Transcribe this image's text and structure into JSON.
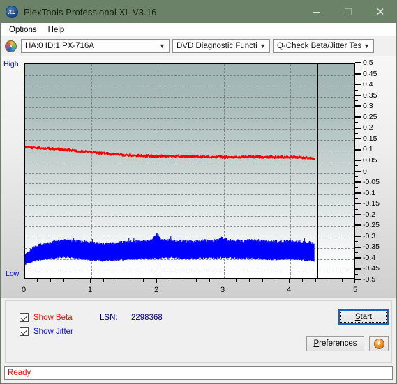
{
  "window": {
    "title": "PlexTools Professional XL V3.16",
    "app_icon": "xl-logo-icon",
    "minimize_label": "—",
    "maximize_label": "□",
    "close_label": "✕"
  },
  "menubar": {
    "items": [
      {
        "label": "Options",
        "accel": "O"
      },
      {
        "label": "Help",
        "accel": "H"
      }
    ]
  },
  "toolbar": {
    "drive_icon": "cd-disc-icon",
    "drive": {
      "value": "HA:0 ID:1  PX-716A",
      "chevron": "⌄"
    },
    "function": {
      "value": "DVD Diagnostic Functions",
      "chevron": "⌄"
    },
    "test": {
      "value": "Q-Check Beta/Jitter Test",
      "chevron": "⌄"
    }
  },
  "chart_data": {
    "type": "line",
    "title": "Q-Check Beta/Jitter Test",
    "xlabel": "",
    "ylabel": "",
    "xlim": [
      0,
      5
    ],
    "ylim": [
      -0.5,
      0.5
    ],
    "xticks": [
      0,
      1,
      2,
      3,
      4,
      5
    ],
    "xtick_labels": [
      "0",
      "1",
      "2",
      "3",
      "4",
      "5"
    ],
    "yticks": [
      0.5,
      0.45,
      0.4,
      0.35,
      0.3,
      0.25,
      0.2,
      0.15,
      0.1,
      0.05,
      0,
      -0.05,
      -0.1,
      -0.15,
      -0.2,
      -0.25,
      -0.3,
      -0.35,
      -0.4,
      -0.45,
      -0.5
    ],
    "ytick_labels": [
      "0.5",
      "0.45",
      "0.4",
      "0.35",
      "0.3",
      "0.25",
      "0.2",
      "0.15",
      "0.1",
      "0.05",
      "0",
      "-0.05",
      "-0.1",
      "-0.15",
      "-0.2",
      "-0.25",
      "-0.3",
      "-0.35",
      "-0.4",
      "-0.45",
      "-0.5"
    ],
    "axis_top_label": "High",
    "axis_bottom_label": "Low",
    "grid": true,
    "grid_style": "dashed",
    "data_end_x": 4.4,
    "legend_position": "below-left",
    "series": [
      {
        "name": "Beta",
        "color": "#ff0000",
        "x_start": 0.0,
        "x_end": 4.4,
        "description": "Beta value declines from about 0.11 near the disc start to about 0.06, then stays roughly flat with small noise",
        "x": [
          0.0,
          0.1,
          0.2,
          0.3,
          0.4,
          0.5,
          0.6,
          0.7,
          0.8,
          0.9,
          1.0,
          1.1,
          1.2,
          1.3,
          1.4,
          1.5,
          1.6,
          1.7,
          1.8,
          1.9,
          2.0,
          2.1,
          2.2,
          2.3,
          2.4,
          2.5,
          2.6,
          2.7,
          2.8,
          2.9,
          3.0,
          3.1,
          3.2,
          3.3,
          3.4,
          3.5,
          3.6,
          3.7,
          3.8,
          3.9,
          4.0,
          4.1,
          4.2,
          4.3,
          4.4
        ],
        "values": [
          0.112,
          0.11,
          0.109,
          0.107,
          0.105,
          0.103,
          0.1,
          0.098,
          0.095,
          0.092,
          0.089,
          0.086,
          0.083,
          0.08,
          0.078,
          0.076,
          0.074,
          0.073,
          0.072,
          0.071,
          0.069,
          0.072,
          0.071,
          0.07,
          0.069,
          0.068,
          0.068,
          0.067,
          0.067,
          0.066,
          0.066,
          0.065,
          0.064,
          0.065,
          0.068,
          0.067,
          0.066,
          0.066,
          0.065,
          0.066,
          0.066,
          0.065,
          0.064,
          0.062,
          0.058
        ]
      },
      {
        "name": "Jitter",
        "color": "#0000ff",
        "x_start": 0.0,
        "x_end": 4.4,
        "description": "Jitter drawn as a dense noisy band; upper and lower envelope given per x",
        "x": [
          0.0,
          0.1,
          0.2,
          0.3,
          0.4,
          0.5,
          0.6,
          0.7,
          0.8,
          0.9,
          1.0,
          1.1,
          1.2,
          1.3,
          1.4,
          1.5,
          1.6,
          1.7,
          1.8,
          1.9,
          2.0,
          2.1,
          2.2,
          2.3,
          2.4,
          2.5,
          2.6,
          2.7,
          2.8,
          2.9,
          3.0,
          3.1,
          3.2,
          3.3,
          3.4,
          3.5,
          3.6,
          3.7,
          3.8,
          3.9,
          4.0,
          4.1,
          4.2,
          4.3,
          4.4
        ],
        "upper": [
          -0.4,
          -0.37,
          -0.352,
          -0.345,
          -0.34,
          -0.334,
          -0.33,
          -0.332,
          -0.335,
          -0.338,
          -0.342,
          -0.345,
          -0.348,
          -0.345,
          -0.342,
          -0.34,
          -0.338,
          -0.336,
          -0.334,
          -0.336,
          -0.3,
          -0.332,
          -0.33,
          -0.332,
          -0.334,
          -0.336,
          -0.334,
          -0.332,
          -0.33,
          -0.332,
          -0.318,
          -0.33,
          -0.332,
          -0.334,
          -0.33,
          -0.332,
          -0.334,
          -0.336,
          -0.338,
          -0.336,
          -0.334,
          -0.336,
          -0.338,
          -0.34,
          -0.344
        ],
        "lower": [
          -0.432,
          -0.42,
          -0.412,
          -0.408,
          -0.404,
          -0.4,
          -0.398,
          -0.4,
          -0.404,
          -0.408,
          -0.412,
          -0.414,
          -0.416,
          -0.414,
          -0.412,
          -0.41,
          -0.408,
          -0.406,
          -0.404,
          -0.406,
          -0.404,
          -0.402,
          -0.4,
          -0.402,
          -0.404,
          -0.406,
          -0.404,
          -0.402,
          -0.4,
          -0.402,
          -0.4,
          -0.4,
          -0.402,
          -0.404,
          -0.402,
          -0.404,
          -0.406,
          -0.408,
          -0.41,
          -0.408,
          -0.406,
          -0.408,
          -0.41,
          -0.412,
          -0.416
        ]
      }
    ]
  },
  "controls": {
    "show_beta": {
      "label_pre": "Show ",
      "accel": "B",
      "label_post": "eta",
      "checked": true,
      "color": "#ff0000"
    },
    "show_jitter": {
      "label_pre": "Show ",
      "accel": "J",
      "label_post": "itter",
      "checked": true,
      "color": "#0000ff"
    },
    "lsn_label": "LSN:",
    "lsn_value": "2298368",
    "start_button": {
      "pre": "",
      "accel": "S",
      "post": "tart"
    },
    "preferences_button": {
      "pre": "",
      "accel": "P",
      "post": "references"
    },
    "info_button": {
      "glyph": "i",
      "name": "info-icon"
    }
  },
  "statusbar": {
    "text": "Ready"
  }
}
